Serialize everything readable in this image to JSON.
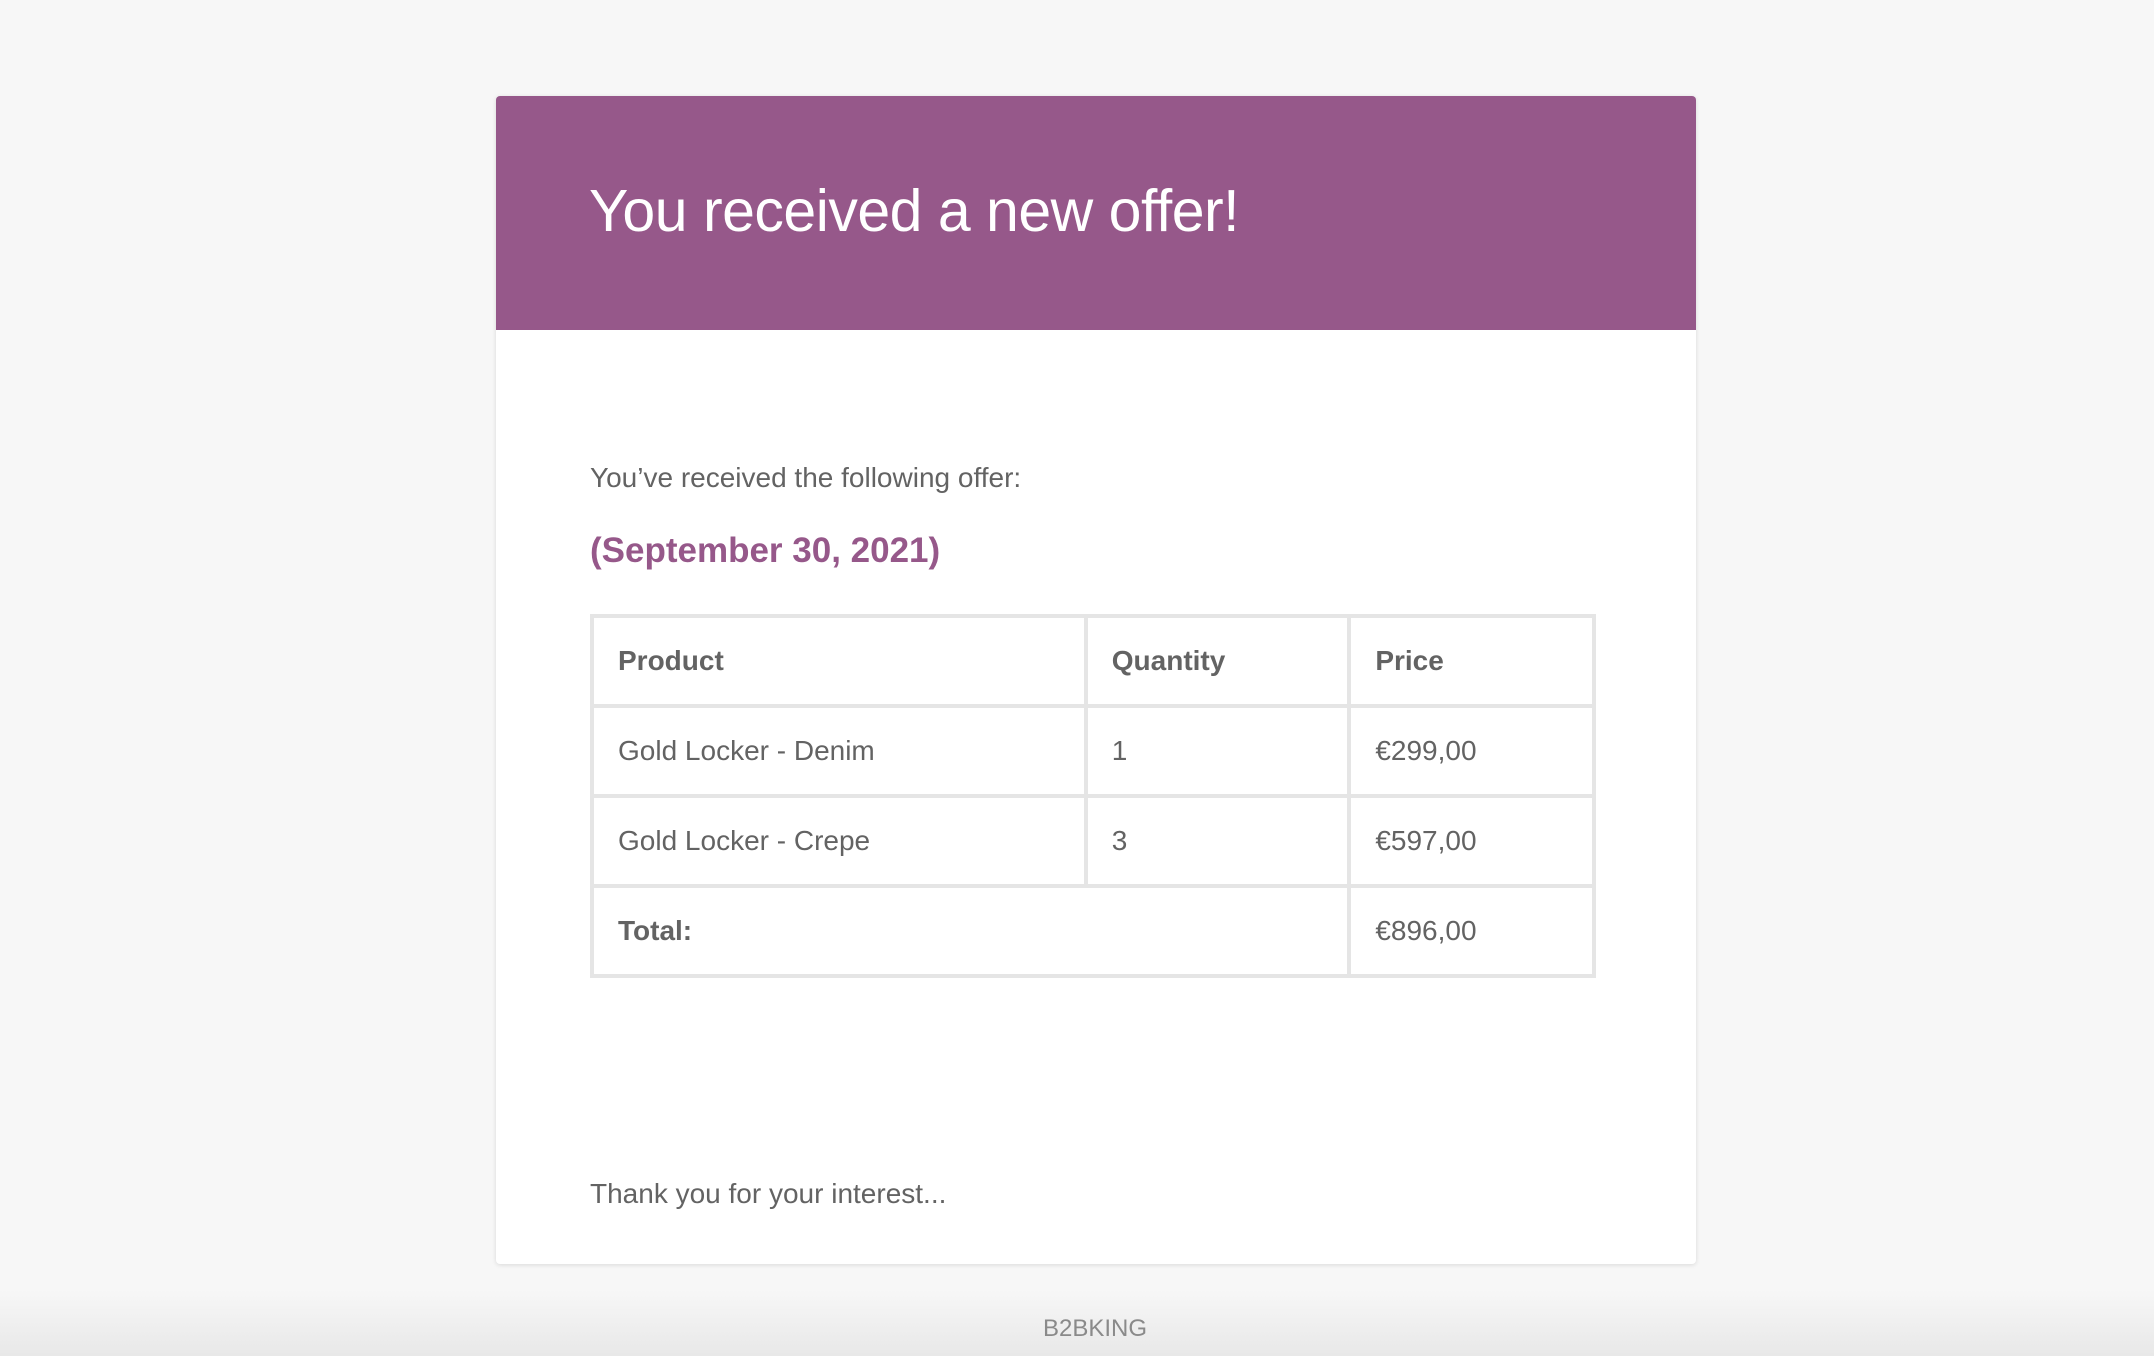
{
  "email": {
    "heading": "You received a new offer!",
    "intro": "You’ve received the following offer:",
    "date": "(September 30, 2021)",
    "table": {
      "headers": [
        "Product",
        "Quantity",
        "Price"
      ],
      "rows": [
        {
          "product": "Gold Locker - Denim",
          "quantity": "1",
          "price": "€299,00"
        },
        {
          "product": "Gold Locker - Crepe",
          "quantity": "3",
          "price": "€597,00"
        }
      ],
      "total_label": "Total:",
      "total_value": "€896,00"
    },
    "thanks": "Thank you for your interest..."
  },
  "footer": {
    "brand": "B2BKING"
  },
  "colors": {
    "header_bg": "#96588a",
    "accent": "#96588a",
    "text": "#636363",
    "border": "#e5e5e5",
    "page_bg": "#f7f7f7"
  }
}
